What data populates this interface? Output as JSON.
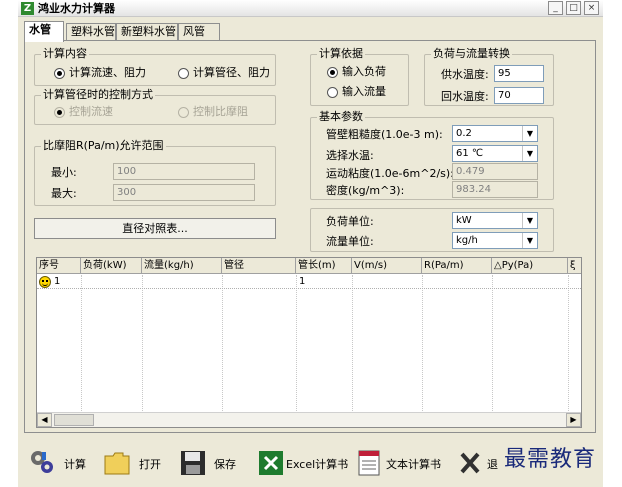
{
  "window": {
    "title": "鸿业水力计算器",
    "controls": [
      "_",
      "□",
      "×"
    ]
  },
  "tabs": [
    "水管",
    "塑料水管",
    "新塑料水管",
    "风管"
  ],
  "calc_content": {
    "title": "计算内容",
    "options": [
      "计算流速、阻力",
      "计算管径、阻力"
    ]
  },
  "control_method": {
    "title": "计算管径时的控制方式",
    "options": [
      "控制流速",
      "控制比摩阻"
    ]
  },
  "friction_range": {
    "title": "比摩阻R(Pa/m)允许范围",
    "min_label": "最小:",
    "min_value": "100",
    "max_label": "最大:",
    "max_value": "300"
  },
  "diameter_button": "直径对照表...",
  "calc_basis": {
    "title": "计算依据",
    "options": [
      "输入负荷",
      "输入流量"
    ]
  },
  "load_conversion": {
    "title": "负荷与流量转换",
    "supply_label": "供水温度:",
    "supply_value": "95",
    "return_label": "回水温度:",
    "return_value": "70"
  },
  "basic_params": {
    "title": "基本参数",
    "roughness_label": "管壁粗糙度(1.0e-3 m):",
    "roughness_value": "0.2",
    "water_temp_label": "选择水温:",
    "water_temp_value": "61  ℃",
    "viscosity_label": "运动粘度(1.0e-6m^2/s):",
    "viscosity_value": "0.479",
    "density_label": "密度(kg/m^3):",
    "density_value": "983.24"
  },
  "units": {
    "load_label": "负荷单位:",
    "load_value": "kW",
    "flow_label": "流量单位:",
    "flow_value": "kg/h"
  },
  "grid": {
    "columns": [
      "序号",
      "负荷(kW)",
      "流量(kg/h)",
      "管径",
      "管长(m)",
      "V(m/s)",
      "R(Pa/m)",
      "△Py(Pa)",
      "ξ"
    ],
    "rows": [
      {
        "index": "1",
        "length": "1"
      }
    ]
  },
  "toolbar": {
    "calc": "计算",
    "open": "打开",
    "save": "保存",
    "excel": "Excel计算书",
    "text": "文本计算书",
    "exit": "退"
  },
  "watermark": "最需教育",
  "colors": {
    "window_bg": "#ece9d8",
    "excel_green": "#1e7b2e",
    "folder_yellow": "#f0cf5a",
    "watermark": "#1a2a7a"
  }
}
